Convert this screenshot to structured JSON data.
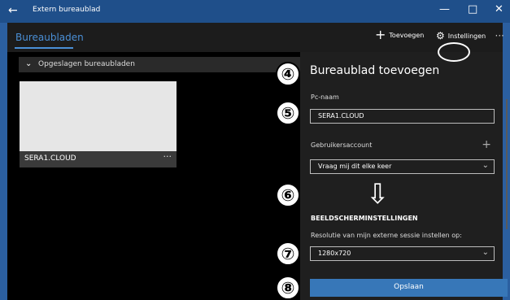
{
  "titlebar": {
    "back": "←",
    "title": "Extern bureaublad",
    "minimize": "—",
    "maximize": "□",
    "close": "✕"
  },
  "header": {
    "tab_active": "Bureaubladen",
    "add_label": "Toevoegen",
    "settings_label": "Instellingen",
    "more": "···"
  },
  "left": {
    "saved_group_label": "Opgeslagen bureaubladen",
    "tile_name": "SERA1.CLOUD",
    "tile_more": "···"
  },
  "panel": {
    "title": "Bureaublad toevoegen",
    "pc_label": "Pc-naam",
    "pc_value": "SERA1.CLOUD",
    "account_label": "Gebruikersaccount",
    "account_value": "Vraag mij dit elke keer",
    "section": "BEELDSCHERMINSTELLINGEN",
    "resolution_label": "Resolutie van mijn externe sessie instellen op:",
    "resolution_value": "1280x720",
    "save_label": "Opslaan"
  },
  "annotations": {
    "n4": "④",
    "n5": "⑤",
    "n6": "⑥",
    "n7": "⑦",
    "n8": "⑧",
    "arrow": "⇩"
  }
}
